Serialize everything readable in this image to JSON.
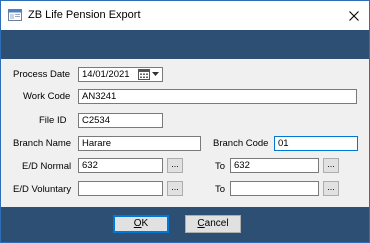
{
  "window": {
    "title": "ZB Life Pension Export"
  },
  "form": {
    "process_date": {
      "label": "Process Date",
      "value": "14/01/2021"
    },
    "work_code": {
      "label": "Work Code",
      "value": "AN3241"
    },
    "file_id": {
      "label": "File  ID",
      "value": "C2534"
    },
    "branch_name": {
      "label": "Branch Name",
      "value": "Harare"
    },
    "branch_code": {
      "label": "Branch Code",
      "value": "01"
    },
    "ed_normal": {
      "label": "E/D Normal",
      "from": "632",
      "to_label": "To",
      "to": "632"
    },
    "ed_voluntary": {
      "label": "E/D Voluntary",
      "from": "",
      "to_label": "To",
      "to": ""
    },
    "lookup_label": "..."
  },
  "buttons": {
    "ok_mnemonic": "O",
    "ok_rest": "K",
    "cancel_mnemonic": "C",
    "cancel_rest": "ancel"
  },
  "icons": {
    "app": "app-window-icon",
    "close": "close-icon",
    "calendar": "calendar-icon",
    "dropdown": "chevron-down-icon"
  },
  "colors": {
    "header_band": "#2d4f73",
    "panel": "#f0f0f0",
    "focus_border": "#0078d7"
  }
}
